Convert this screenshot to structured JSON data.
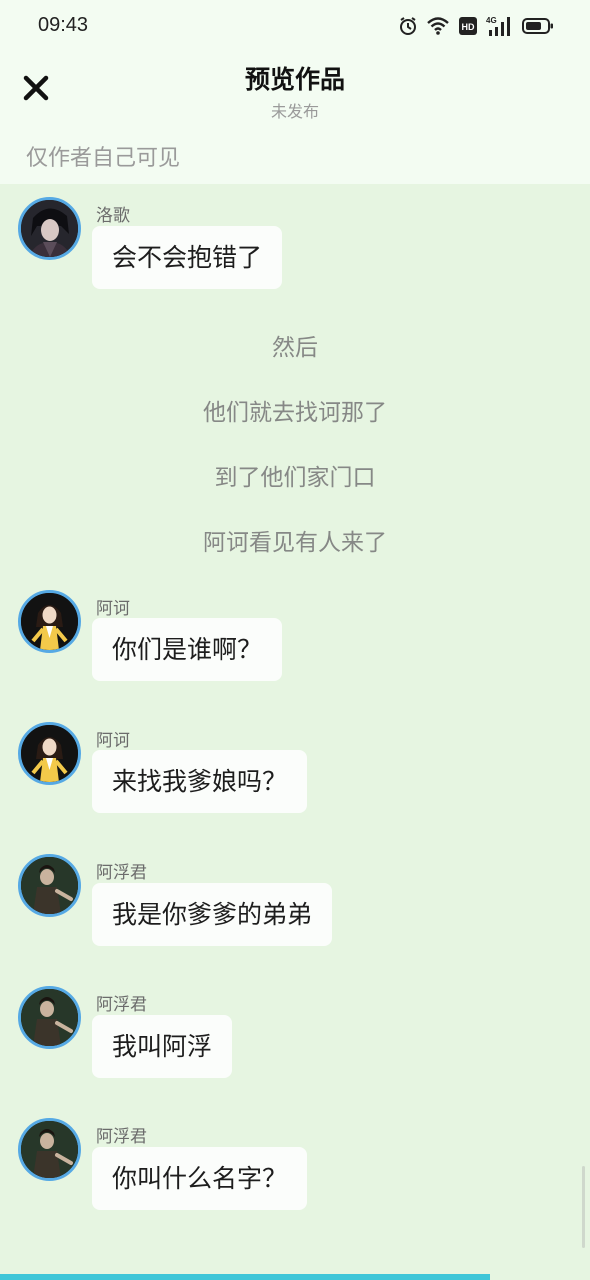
{
  "status_bar": {
    "time": "09:43",
    "icons": [
      "alarm-icon",
      "wifi-icon",
      "hd-icon",
      "signal-4g-icon",
      "battery-icon"
    ],
    "network_label": "4G",
    "hd_label": "HD"
  },
  "header": {
    "close_icon": "close-icon",
    "title": "预览作品",
    "subtitle": "未发布"
  },
  "visibility_note": "仅作者自己可见",
  "messages": [
    {
      "type": "dialogue",
      "speaker": "洛歌",
      "text": "会不会抱错了",
      "avatar": "avatar-luoge"
    },
    {
      "type": "narration",
      "text": "然后"
    },
    {
      "type": "narration",
      "text": "他们就去找诃那了"
    },
    {
      "type": "narration",
      "text": "到了他们家门口"
    },
    {
      "type": "narration",
      "text": "阿诃看见有人来了"
    },
    {
      "type": "dialogue",
      "speaker": "阿诃",
      "text": "你们是谁啊？",
      "avatar": "avatar-ahe"
    },
    {
      "type": "dialogue",
      "speaker": "阿诃",
      "text": "来找我爹娘吗？",
      "avatar": "avatar-ahe"
    },
    {
      "type": "dialogue",
      "speaker": "阿浮君",
      "text": "我是你爹爹的弟弟",
      "avatar": "avatar-afujun"
    },
    {
      "type": "dialogue",
      "speaker": "阿浮君",
      "text": "我叫阿浮",
      "avatar": "avatar-afujun"
    },
    {
      "type": "dialogue",
      "speaker": "阿浮君",
      "text": "你叫什么名字？",
      "avatar": "avatar-afujun"
    }
  ],
  "reading_progress": 0.83,
  "colors": {
    "background": "#e6f5e1",
    "header_background": "#f3fcf2",
    "bubble": "#fbfdfb",
    "avatar_ring": "#56a9e4",
    "progress": "#3fc6d8",
    "narration_text": "#868886"
  }
}
